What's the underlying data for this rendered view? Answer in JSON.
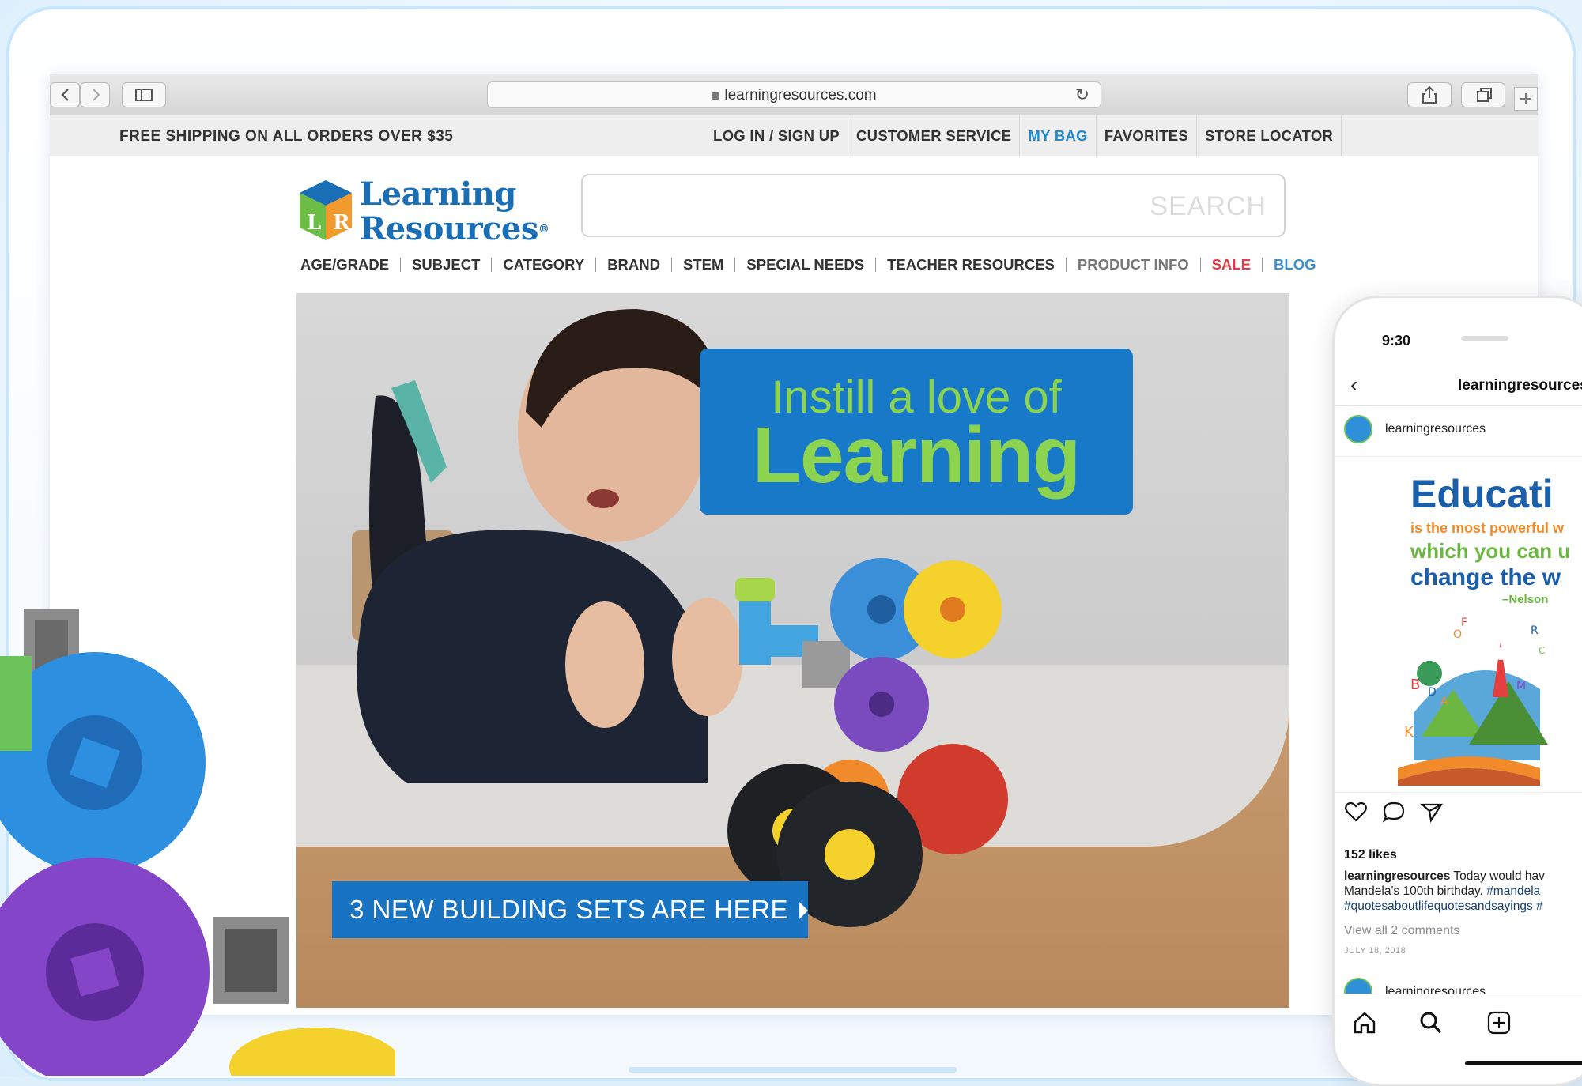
{
  "browser": {
    "url": "learningresources.com"
  },
  "utility_bar": {
    "promo": "FREE SHIPPING ON ALL ORDERS OVER $35",
    "links": [
      "LOG IN / SIGN UP",
      "CUSTOMER SERVICE",
      "MY BAG",
      "FAVORITES",
      "STORE LOCATOR"
    ]
  },
  "header": {
    "logo_line1": "Learning",
    "logo_line2": "Resources",
    "logo_mark": "®",
    "search_placeholder": "SEARCH"
  },
  "main_nav": [
    "AGE/GRADE",
    "SUBJECT",
    "CATEGORY",
    "BRAND",
    "STEM",
    "SPECIAL NEEDS",
    "TEACHER RESOURCES",
    "PRODUCT INFO",
    "SALE",
    "BLOG"
  ],
  "hero": {
    "badge_line1": "Instill a love of",
    "badge_line2": "Learning",
    "cta": "3 NEW BUILDING SETS ARE HERE"
  },
  "phone": {
    "time": "9:30",
    "header_title": "learningresources",
    "username": "learningresources",
    "post": {
      "headline": "Educati",
      "line1": "is the most powerful w",
      "line2": "which you can u",
      "line3": "change the w",
      "attribution": "–Nelson",
      "letters": [
        "O",
        "F",
        "R",
        "C",
        "B",
        "D",
        "A",
        "M",
        "K"
      ]
    },
    "likes": "152 likes",
    "caption_user": "learningresources",
    "caption_text": " Today would hav",
    "caption_line2": "Mandela's 100th birthday. ",
    "caption_tag1": "#mandela",
    "caption_tag2": "#quotesaboutlifequotesandsayings",
    "caption_tag2_tail": " #",
    "view_comments": "View all 2 comments",
    "date": "JULY 18, 2018",
    "next_username": "learningresources"
  },
  "colors": {
    "brand_blue": "#1873c2",
    "brand_green": "#8cd350",
    "sale_red": "#e63946",
    "link_blue": "#1d8ad1"
  }
}
